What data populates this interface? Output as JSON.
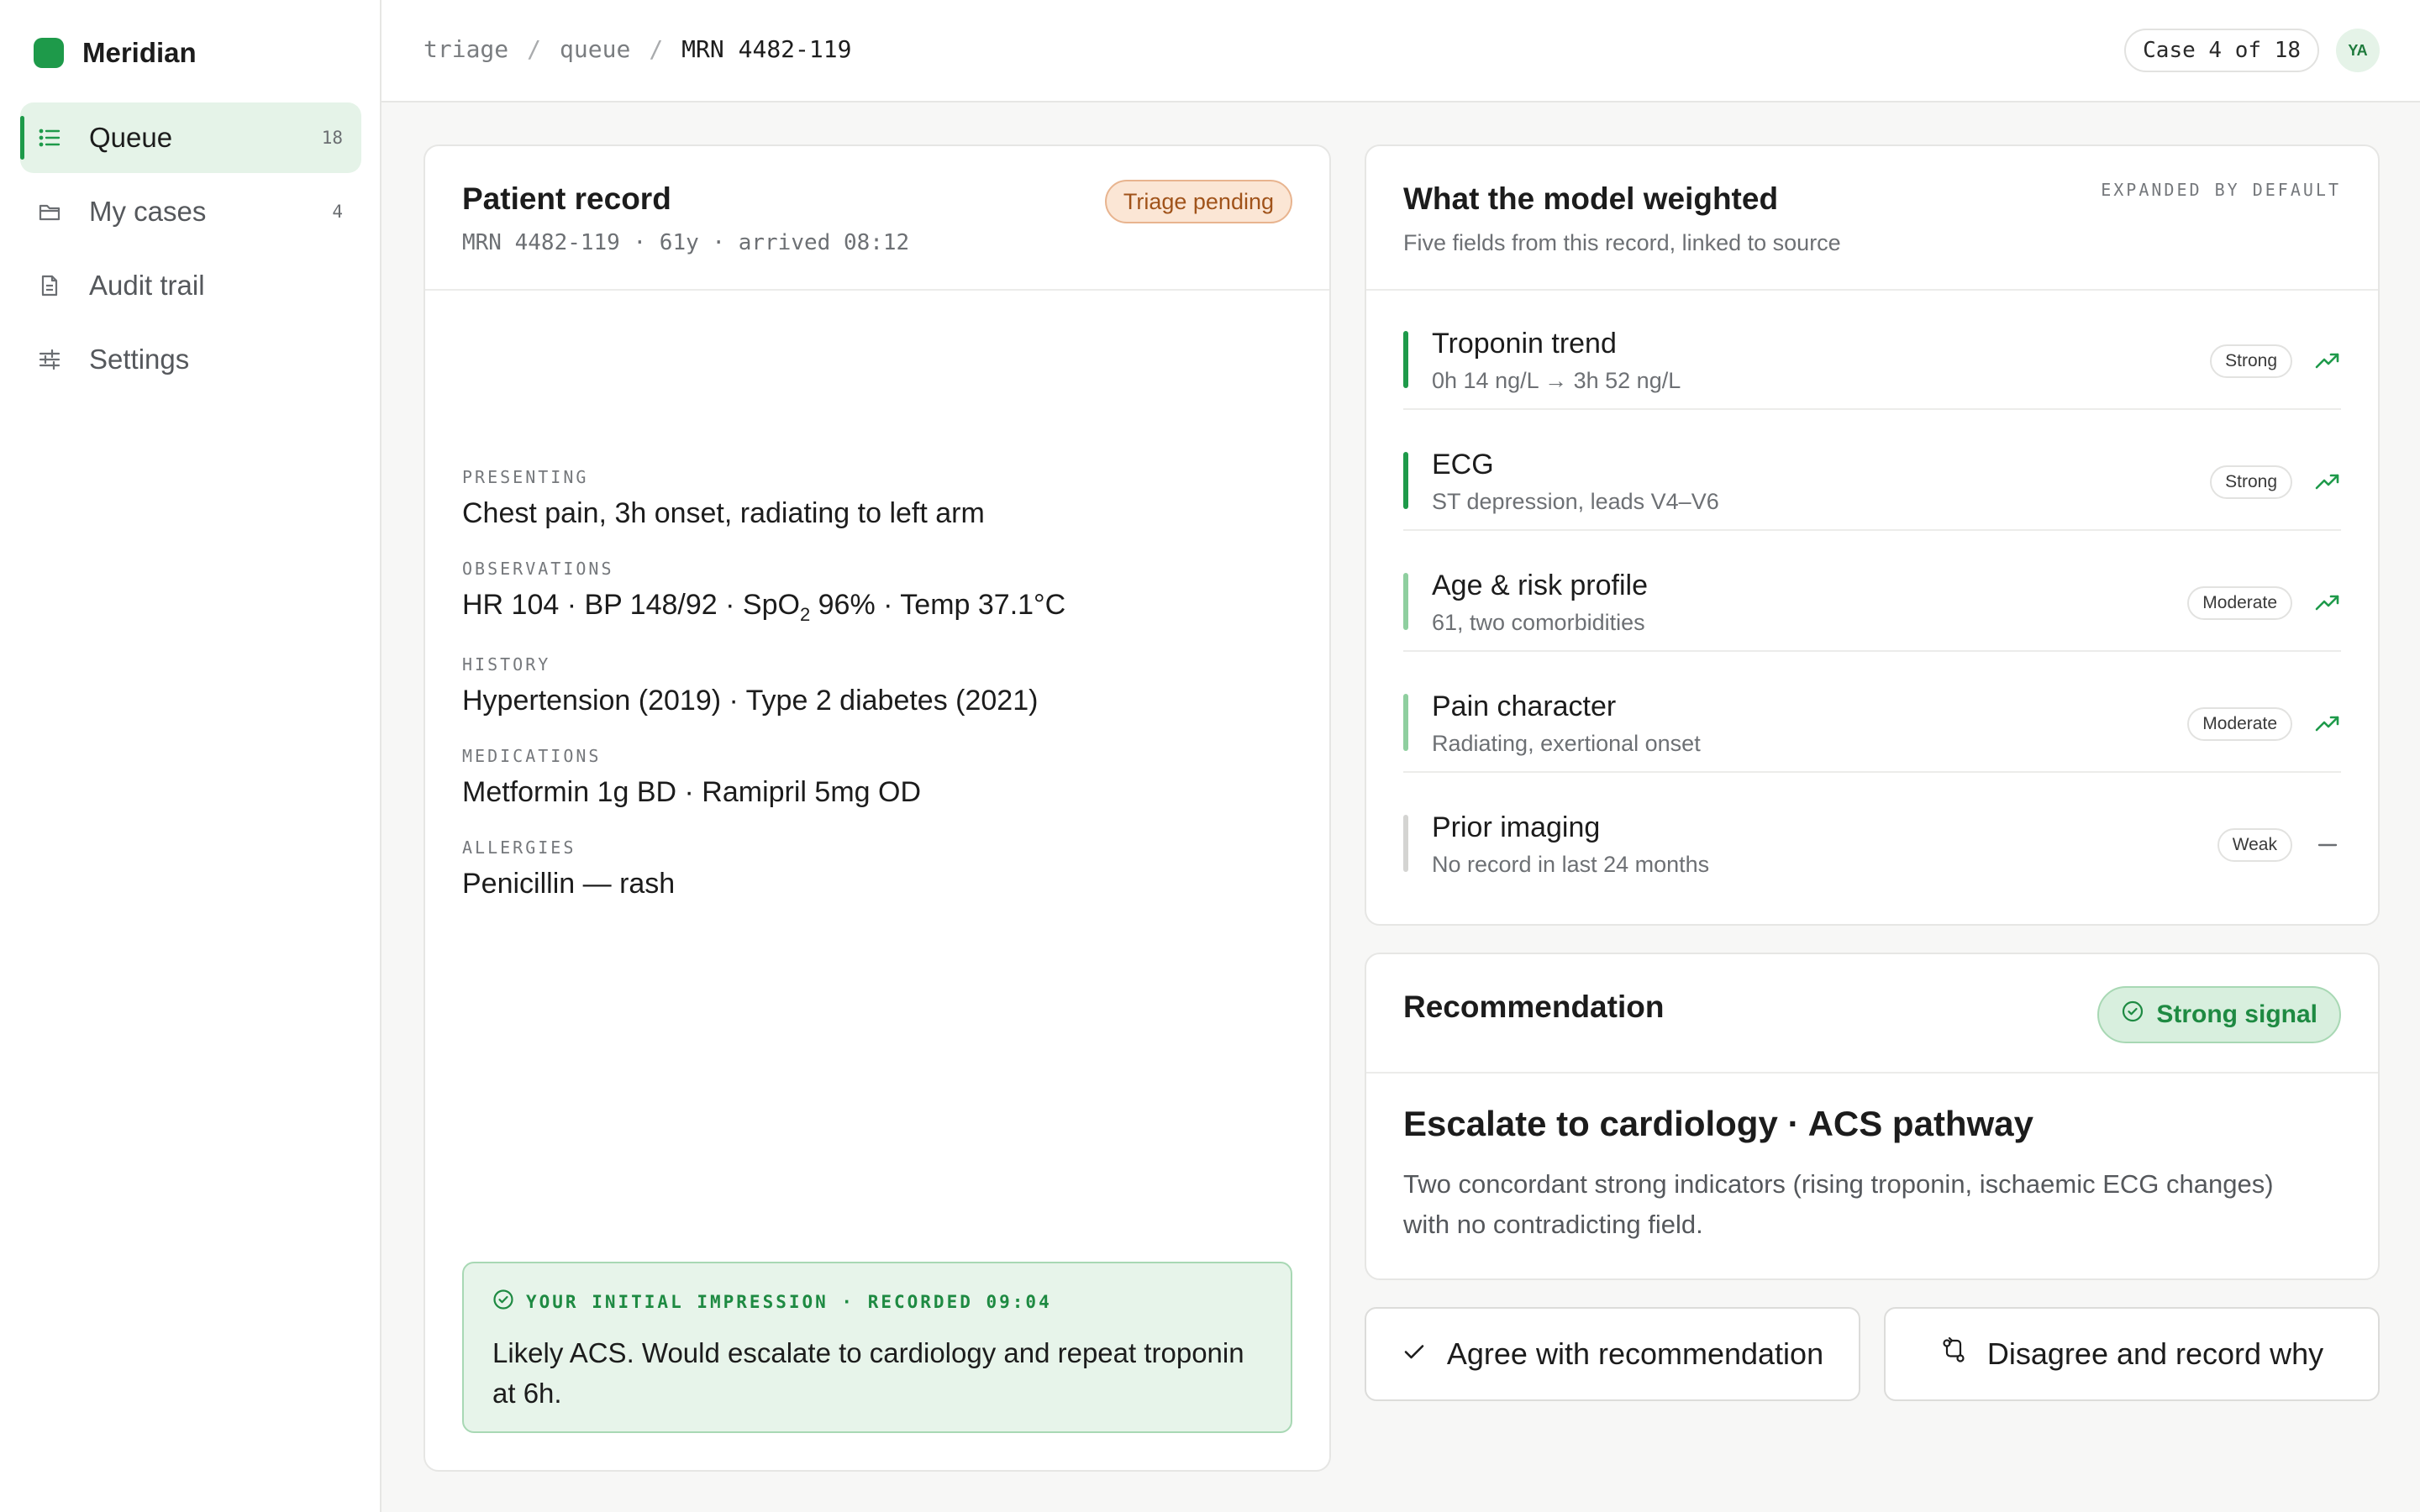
{
  "brand": {
    "name": "Meridian",
    "color": "#1e9a4a"
  },
  "sidebar": {
    "items": [
      {
        "label": "Queue",
        "count": "18",
        "icon": "list-icon",
        "active": true
      },
      {
        "label": "My cases",
        "count": "4",
        "icon": "folder-icon",
        "active": false
      },
      {
        "label": "Audit trail",
        "count": "",
        "icon": "document-icon",
        "active": false
      },
      {
        "label": "Settings",
        "count": "",
        "icon": "sliders-icon",
        "active": false
      }
    ]
  },
  "header": {
    "breadcrumb": [
      "triage",
      "queue",
      "MRN 4482-119"
    ],
    "case_position": "Case 4 of 18",
    "avatar_initials": "YA"
  },
  "patient": {
    "title": "Patient record",
    "subtitle": "MRN 4482-119 · 61y · arrived 08:12",
    "status": "Triage pending",
    "fields": [
      {
        "label": "PRESENTING",
        "value": "Chest pain, 3h onset, radiating to left arm"
      },
      {
        "label": "OBSERVATIONS",
        "value_pre": "HR 104 · BP 148/92 · SpO",
        "value_sub": "2",
        "value_post": " 96% · Temp 37.1°C"
      },
      {
        "label": "HISTORY",
        "value": "Hypertension (2019) · Type 2 diabetes (2021)"
      },
      {
        "label": "MEDICATIONS",
        "value": "Metformin 1g BD · Ramipril 5mg OD"
      },
      {
        "label": "ALLERGIES",
        "value": "Penicillin — rash"
      }
    ],
    "impression": {
      "label": "YOUR INITIAL IMPRESSION · RECORDED 09:04",
      "text": "Likely ACS. Would escalate to cardiology and repeat troponin at 6h."
    }
  },
  "weights": {
    "title": "What the model weighted",
    "subtitle": "Five fields from this record, linked to source",
    "mode": "EXPANDED BY DEFAULT",
    "items": [
      {
        "name": "Troponin trend",
        "detail": "0h 14 ng/L → 3h 52 ng/L",
        "strength": "Strong",
        "bar_color": "#1e9a4a",
        "icon": "trend-up-icon"
      },
      {
        "name": "ECG",
        "detail": "ST depression, leads V4–V6",
        "strength": "Strong",
        "bar_color": "#1e9a4a",
        "icon": "trend-up-icon"
      },
      {
        "name": "Age & risk profile",
        "detail": "61, two comorbidities",
        "strength": "Moderate",
        "bar_color": "#8fcf9f",
        "icon": "trend-up-icon"
      },
      {
        "name": "Pain character",
        "detail": "Radiating, exertional onset",
        "strength": "Moderate",
        "bar_color": "#8fcf9f",
        "icon": "trend-up-icon"
      },
      {
        "name": "Prior imaging",
        "detail": "No record in last 24 months",
        "strength": "Weak",
        "bar_color": "#d4d4d2",
        "icon": "dash-icon"
      }
    ]
  },
  "recommendation": {
    "title": "Recommendation",
    "signal": "Strong signal",
    "headline": "Escalate to cardiology · ACS pathway",
    "body": "Two concordant strong indicators (rising troponin, ischaemic ECG changes) with no contradicting field."
  },
  "actions": {
    "agree": "Agree with recommendation",
    "disagree": "Disagree and record why"
  }
}
